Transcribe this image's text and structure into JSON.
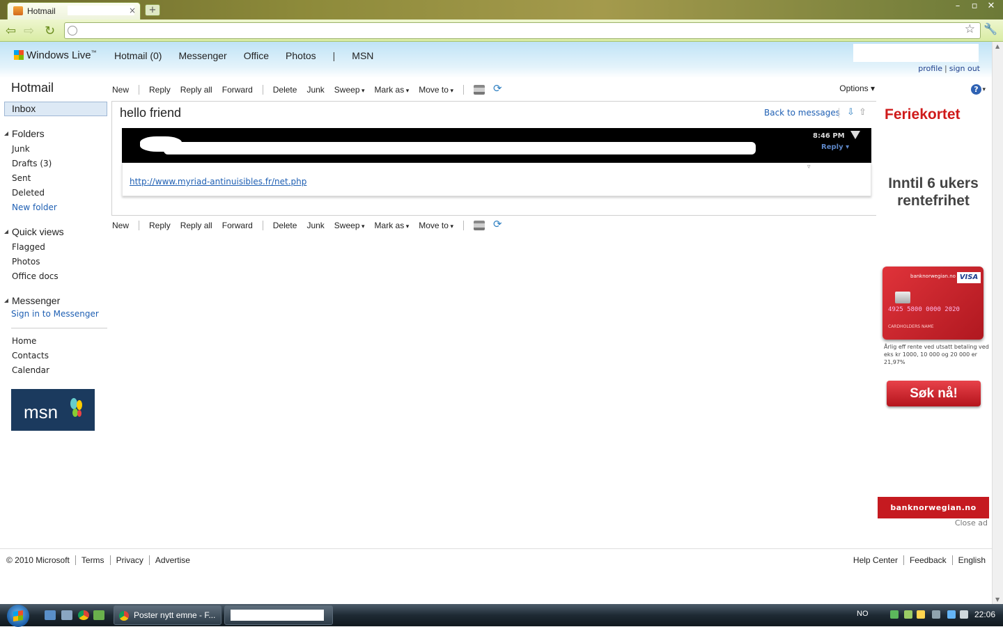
{
  "browser": {
    "tab_title": "Hotmail",
    "tab_close": "×",
    "new_tab": "+",
    "window_buttons": [
      "–",
      "▫",
      "✕"
    ],
    "url": "",
    "back": "⇦",
    "forward": "⇨",
    "reload": "↻",
    "star": "☆",
    "wrench": "🔧"
  },
  "header": {
    "brand": "Windows Live",
    "brand_tm": "™",
    "nav": [
      "Hotmail (0)",
      "Messenger",
      "Office",
      "Photos",
      "|",
      "MSN"
    ],
    "profile": "profile",
    "signout": "sign out",
    "sep": "|"
  },
  "sidebar": {
    "app_title": "Hotmail",
    "inbox": "Inbox",
    "folders_heading": "Folders",
    "folders": [
      "Junk",
      "Drafts (3)",
      "Sent",
      "Deleted"
    ],
    "new_folder": "New folder",
    "quickviews_heading": "Quick views",
    "quickviews": [
      "Flagged",
      "Photos",
      "Office docs"
    ],
    "messenger_heading": "Messenger",
    "sign_in": "Sign in to Messenger",
    "bottom": [
      "Home",
      "Contacts",
      "Calendar"
    ],
    "msn_logo": "msn"
  },
  "commands": {
    "new": "New",
    "reply": "Reply",
    "reply_all": "Reply all",
    "forward": "Forward",
    "delete": "Delete",
    "junk": "Junk",
    "sweep": "Sweep",
    "mark_as": "Mark as",
    "move_to": "Move to",
    "options": "Options",
    "help": "?",
    "refresh_icon": "⟳"
  },
  "message": {
    "subject": "hello friend",
    "back_to_messages": "Back to messages",
    "next_icon": "⇩",
    "prev_icon": "⇧",
    "time": "8:46 PM",
    "reply": "Reply ▾",
    "collapse_icon": "▿",
    "link": "http://www.myriad-antinuisibles.fr/net.php"
  },
  "ad": {
    "brand": "Feriekortet",
    "promo": "Inntil 6 ukers rentefrihet",
    "card_bank": "banknorwegian.no",
    "card_visa": "VISA",
    "card_number": "4925 5800 0000 2020",
    "card_holder": "CARDHOLDERS NAME",
    "fine_print": "Årlig eff rente ved utsatt betaling ved eks kr 1000, 10 000 og 20 000 er 21,97%",
    "apply": "Søk nå!",
    "banner": "banknorwegian.no",
    "close_ad": "Close ad"
  },
  "footer": {
    "left": [
      "© 2010 Microsoft",
      "Terms",
      "Privacy",
      "Advertise"
    ],
    "right": [
      "Help Center",
      "Feedback",
      "English"
    ]
  },
  "taskbar": {
    "task1": "Poster nytt emne - F...",
    "lang": "NO",
    "clock": "22:06"
  },
  "scroll": {
    "up": "▲",
    "down": "▼"
  }
}
